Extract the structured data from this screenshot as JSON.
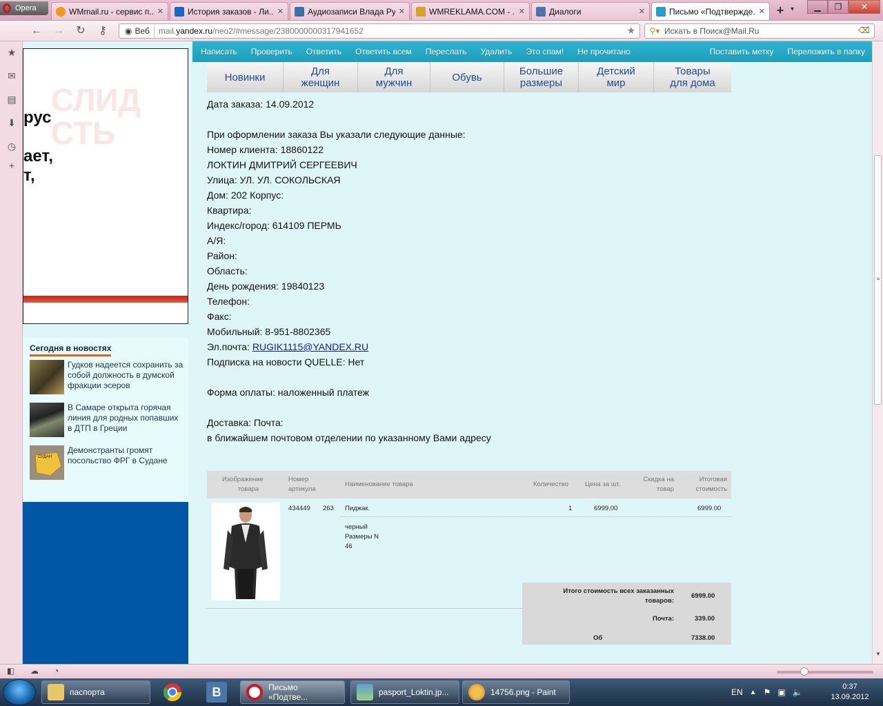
{
  "browser": {
    "menu_label": "Opera",
    "tabs": [
      {
        "title": "WMmail.ru - сервис п...",
        "color": "#f29a18"
      },
      {
        "title": "История заказов - Ли...",
        "color": "#1e66c4"
      },
      {
        "title": "Аудиозаписи Влада Ру...",
        "color": "#3f6fa7"
      },
      {
        "title": "WMREKLAMA.COM - ...",
        "color": "#d8a12c"
      },
      {
        "title": "Диалоги",
        "color": "#4a76a8"
      },
      {
        "title": "Письмо «Подтвержде...",
        "color": "#2a9ec9"
      }
    ],
    "web_badge": "Веб",
    "url_prefix": "mail.",
    "url_host": "yandex.ru",
    "url_path": "/neo2/#message/2380000000317941652",
    "search_placeholder": "Искать в Поиск@Mail.Ru"
  },
  "ad": {
    "bg_text_1": "СЛИД",
    "bg_text_2": "СТЬ",
    "line_1": "рус",
    "line_2": "ает,",
    "line_3": "т,"
  },
  "news": {
    "title": "Сегодня в новостях",
    "items": [
      {
        "text": "Гудков надеется сохранить за собой должность в думской фракции эсеров"
      },
      {
        "text": "В Самаре открыта горячая линия для родных попавших в ДТП в Греции"
      },
      {
        "text": "Демонстранты громят посольство ФРГ в Судане",
        "map_label": "СУДАН"
      }
    ]
  },
  "toolbar": {
    "left": [
      "Написать",
      "Проверить",
      "Ответить",
      "Ответить всем",
      "Переслать",
      "Удалить",
      "Это спам!",
      "Не прочитано"
    ],
    "right": [
      "Поставить метку",
      "Переложить в папку"
    ]
  },
  "store_menu": [
    {
      "line1": "Новинки",
      "line2": ""
    },
    {
      "line1": "Для",
      "line2": "женщин"
    },
    {
      "line1": "Для",
      "line2": "мужчин"
    },
    {
      "line1": "Обувь",
      "line2": ""
    },
    {
      "line1": "Большие",
      "line2": "размеры"
    },
    {
      "line1": "Детский",
      "line2": "мир"
    },
    {
      "line1": "Товары",
      "line2": "для дома"
    }
  ],
  "letter": {
    "order_date": "Дата заказа: 14.09.2012",
    "intro": "При оформлении заказа Вы указали следующие данные:",
    "client_no": "Номер клиента: 18860122",
    "name": "ЛОКТИН ДМИТРИЙ СЕРГЕЕВИЧ",
    "street": "Улица: УЛ. УЛ. СОКОЛЬСКАЯ",
    "house": "Дом: 202 Корпус:",
    "flat": "Квартира:",
    "zip_city": "Индекс/город: 614109 ПЕРМЬ",
    "po_box": "А/Я:",
    "district": "Район:",
    "region": "Область:",
    "birthday": "День рождения: 19840123",
    "phone": "Телефон:",
    "fax": "Факс:",
    "mobile": "Мобильный: 8-951-8802365",
    "email_label": "Эл.почта: ",
    "email": "RUGIK1115@YANDEX.RU",
    "subscription": "Подписка на новости QUELLE: Нет",
    "payment": "Форма оплаты: наложенный платеж",
    "delivery": "Доставка: Почта:",
    "delivery_note": "в ближайшем почтовом отделении по указанному Вами адресу"
  },
  "order_table": {
    "headers": {
      "image": [
        "Изображение",
        "товара"
      ],
      "article": [
        "Номер",
        "артикула"
      ],
      "name": "Наименование товара",
      "qty": "Количество",
      "price": "Цена за шт.",
      "discount": [
        "Скидка на",
        "товар"
      ],
      "total": [
        "Итоговая",
        "стоимость"
      ]
    },
    "row": {
      "article": "434449",
      "size": "263",
      "name": "Пиджак.",
      "qty": "1",
      "price": "6999.00",
      "total": "6999.00",
      "color": "черный",
      "sizes_label": "Размеры N",
      "size_value": "46"
    },
    "totals": {
      "all_label_1": "Итого стоимость всех заказанных",
      "all_label_2": "товаров:",
      "all_value": "6999.00",
      "post_label": "Почта:",
      "post_value": "339.00",
      "cut_label": "Об",
      "cut_value": "7338.00"
    }
  },
  "taskbar": {
    "items": [
      {
        "label": "паспорта",
        "color": "#e8c766"
      },
      {
        "label": "Письмо «Подтве...",
        "color": "#d4121d"
      },
      {
        "label": "pasport_Loktin.jp...",
        "color": "#5ea0d8"
      },
      {
        "label": "14756.png - Paint",
        "color": "#f0c24a"
      }
    ],
    "lang": "EN",
    "time": "0:37",
    "date": "13.09.2012"
  }
}
